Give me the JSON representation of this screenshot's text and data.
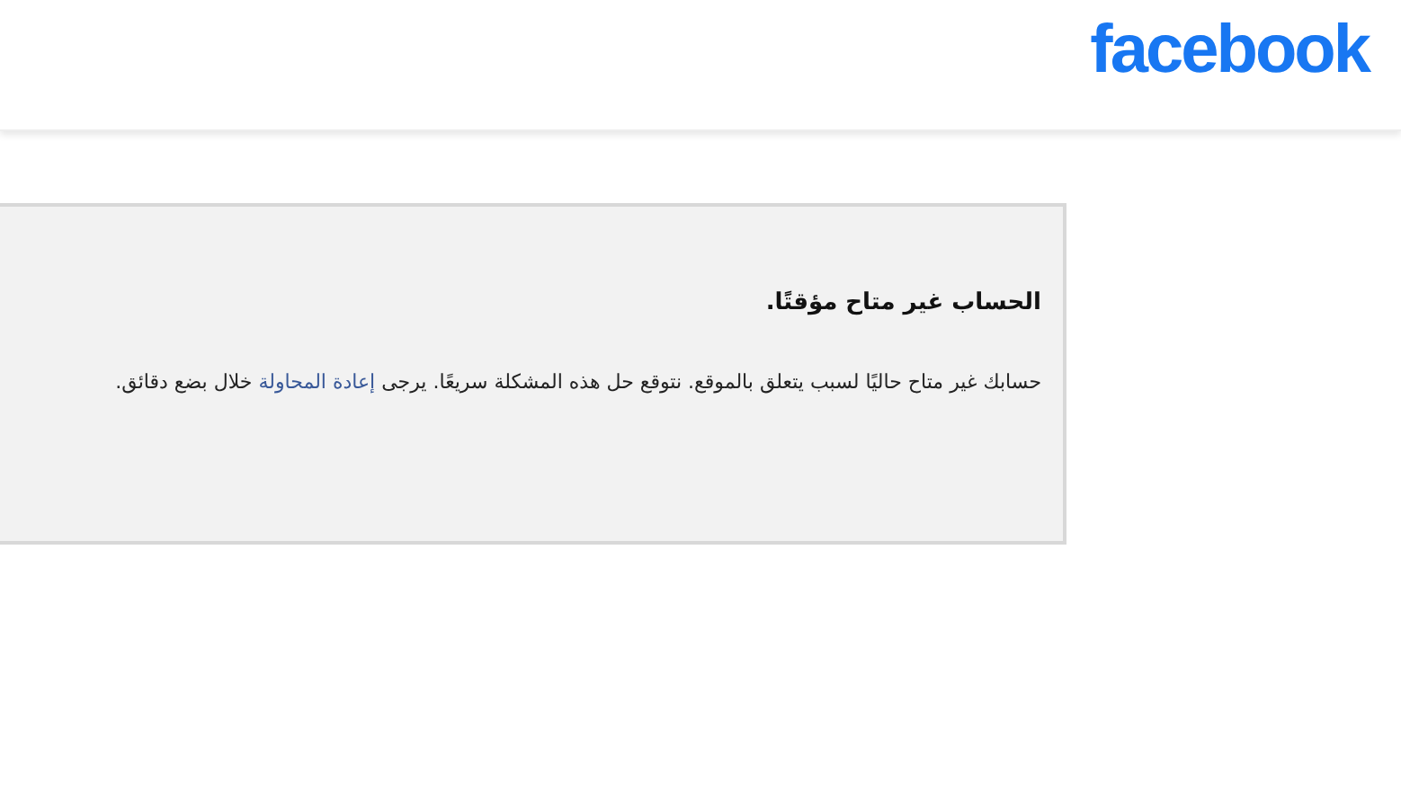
{
  "header": {
    "logo": "facebook"
  },
  "notice": {
    "title": "الحساب غير متاح مؤقتًا.",
    "message_before": "حسابك غير متاح حاليًا لسبب يتعلق بالموقع. نتوقع حل هذه المشكلة سريعًا. يرجى ",
    "link": "إعادة المحاولة",
    "message_after": " خلال بضع دقائق."
  }
}
